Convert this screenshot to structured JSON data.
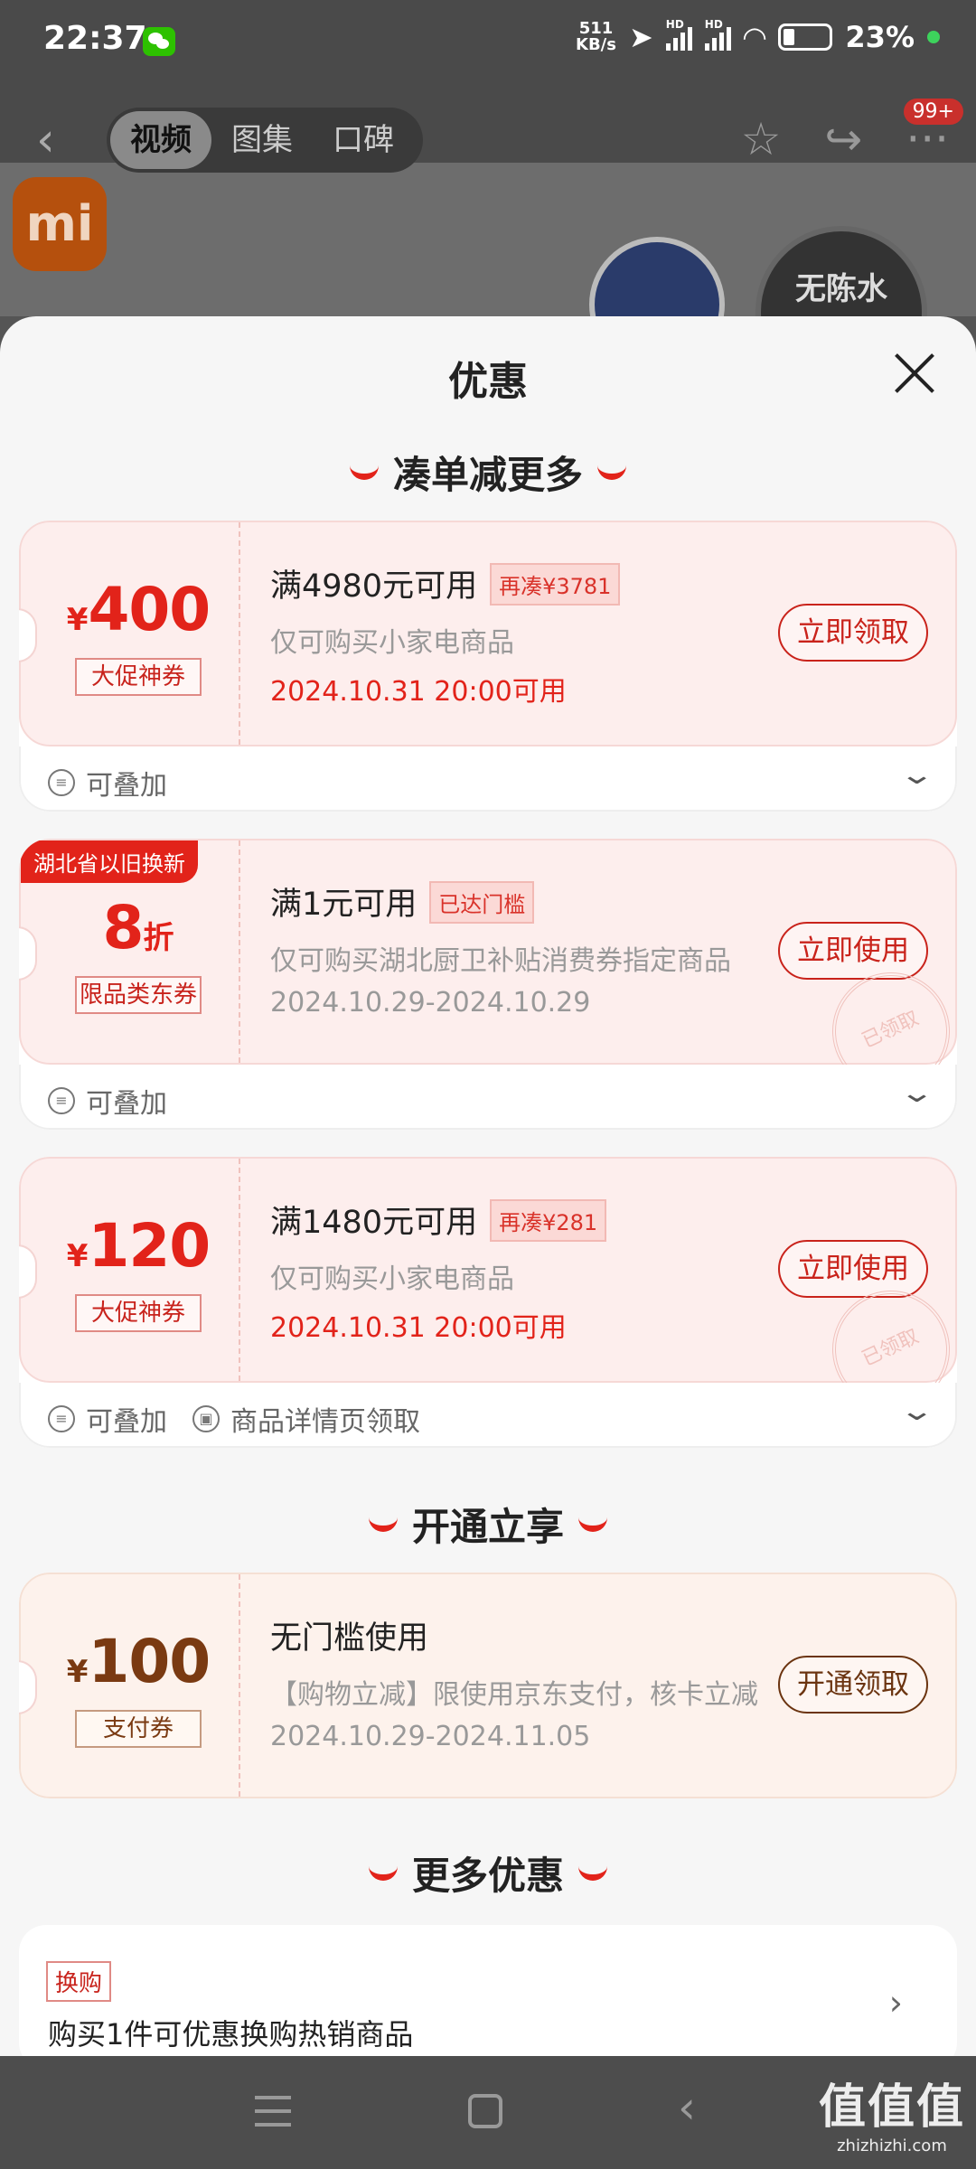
{
  "status": {
    "time": "22:37",
    "net_speed_top": "511",
    "net_speed_bottom": "KB/s",
    "hd1": "HD",
    "hd2": "HD",
    "battery": "23%"
  },
  "nav": {
    "tabs": [
      "视频",
      "图集",
      "口碑"
    ],
    "active_tab": "视频",
    "badge": "99+"
  },
  "background": {
    "logo_text": "mi",
    "ad_text": "无陈水"
  },
  "sheet": {
    "title": "优惠",
    "sections": [
      "凑单减更多",
      "开通立享",
      "更多优惠"
    ]
  },
  "coupons": [
    {
      "yen": "¥",
      "amount": "400",
      "tag": "大促神券",
      "title": "满4980元可用",
      "pill": "再凑¥3781",
      "desc": "仅可购买小家电商品",
      "date": "2024.10.31 20:00可用",
      "button": "立即领取",
      "foot": [
        "可叠加"
      ]
    },
    {
      "corner": "湖北省以旧换新",
      "amount": "8",
      "unit": "折",
      "tag": "限品类东券",
      "title": "满1元可用",
      "pill": "已达门槛",
      "desc": "仅可购买湖北厨卫补贴消费券指定商品",
      "date": "2024.10.29-2024.10.29",
      "button": "立即使用",
      "stamp": "已领取",
      "foot": [
        "可叠加"
      ]
    },
    {
      "yen": "¥",
      "amount": "120",
      "tag": "大促神券",
      "title": "满1480元可用",
      "pill": "再凑¥281",
      "desc": "仅可购买小家电商品",
      "date": "2024.10.31 20:00可用",
      "button": "立即使用",
      "stamp": "已领取",
      "foot": [
        "可叠加",
        "商品详情页领取"
      ]
    },
    {
      "yen": "¥",
      "amount": "100",
      "tag": "支付券",
      "title": "无门槛使用",
      "desc": "【购物立减】限使用京东支付，核卡立减",
      "date": "2024.10.29-2024.11.05",
      "button": "开通领取"
    }
  ],
  "more": {
    "tag": "换购",
    "text": "购买1件可优惠换购热销商品"
  },
  "watermark": {
    "main": "值值值",
    "sub": "zhizhizhi.com"
  },
  "colors": {
    "accent": "#e2231a",
    "brown": "#7a3a12"
  }
}
